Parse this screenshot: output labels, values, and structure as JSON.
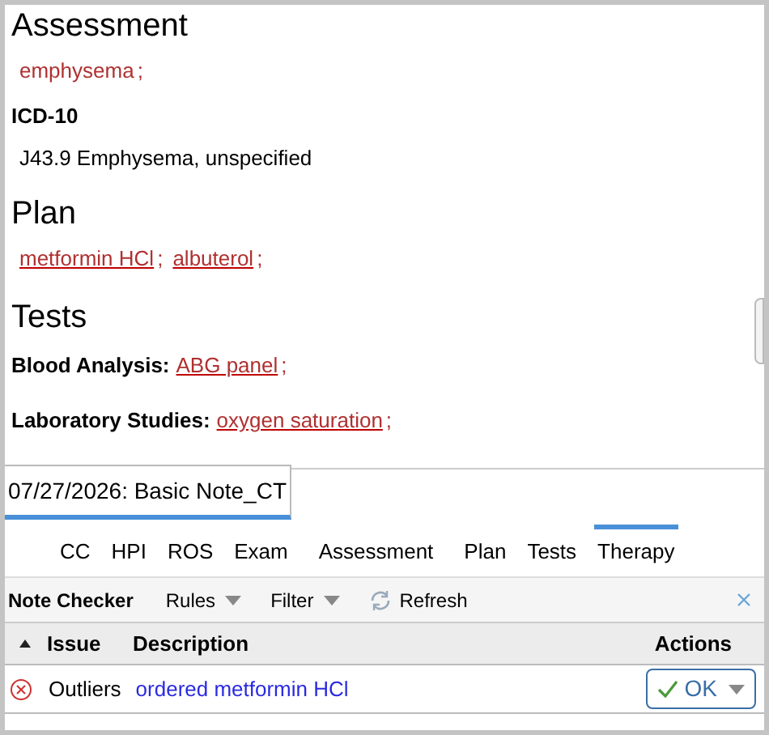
{
  "sections": [
    {
      "heading": "Assessment",
      "items": [
        {
          "kind": "terms",
          "terms": [
            {
              "text": "emphysema",
              "underlined": false
            }
          ]
        },
        {
          "kind": "subheading",
          "text": "ICD-10"
        },
        {
          "kind": "text",
          "text": "J43.9 Emphysema, unspecified"
        }
      ]
    },
    {
      "heading": "Plan",
      "items": [
        {
          "kind": "terms",
          "terms": [
            {
              "text": "metformin HCl",
              "underlined": true
            },
            {
              "text": "albuterol",
              "underlined": true
            }
          ]
        }
      ]
    },
    {
      "heading": "Tests",
      "items": [
        {
          "kind": "labeled",
          "label": "Blood Analysis:",
          "terms": [
            {
              "text": "ABG panel",
              "underlined": true
            }
          ]
        },
        {
          "kind": "labeled",
          "label": "Laboratory Studies:",
          "terms": [
            {
              "text": "oxygen saturation",
              "underlined": true
            }
          ]
        }
      ]
    }
  ],
  "separator": ";",
  "note_tabs": [
    {
      "label": "07/27/2026: Basic Note_CT",
      "selected": true
    }
  ],
  "section_tabs": [
    {
      "label": "CC",
      "selected": false
    },
    {
      "label": "HPI",
      "selected": false
    },
    {
      "label": "ROS",
      "selected": false
    },
    {
      "label": "Exam",
      "selected": false
    },
    {
      "label": "Assessment",
      "selected": false
    },
    {
      "label": "Plan",
      "selected": false
    },
    {
      "label": "Tests",
      "selected": false
    },
    {
      "label": "Therapy",
      "selected": true
    }
  ],
  "note_checker": {
    "title": "Note Checker",
    "menus": [
      "Rules",
      "Filter"
    ],
    "refresh": "Refresh",
    "columns": [
      "Issue",
      "Description",
      "Actions"
    ],
    "rows": [
      {
        "issue": "Outliers",
        "description": "ordered metformin HCl",
        "action": "OK"
      }
    ]
  }
}
